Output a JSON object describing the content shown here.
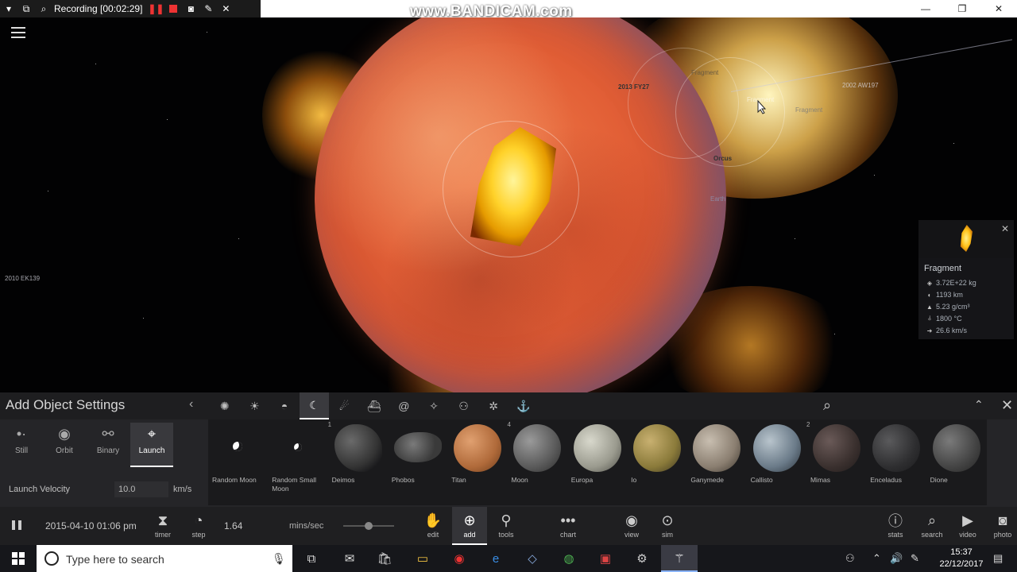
{
  "recorder": {
    "status_text": "Recording [00:02:29]",
    "watermark": "www.BANDICAM.com"
  },
  "space": {
    "labels": {
      "fy27": "2013 FY27",
      "fragment_1": "Fragment",
      "fragment_2": "Fragment",
      "fragment_3": "Fragment",
      "orcus": "Orcus",
      "earth": "Earth",
      "aw197": "2002 AW197",
      "ek139": "2010 EK139"
    }
  },
  "info_panel": {
    "name": "Fragment",
    "mass": "3.72E+22 kg",
    "radius": "1193 km",
    "density": "5.23 g/cm³",
    "temperature": "1800 °C",
    "velocity": "26.6 km/s"
  },
  "panel": {
    "title": "Add Object Settings",
    "modes": [
      {
        "label": "Still",
        "icon": "still-icon"
      },
      {
        "label": "Orbit",
        "icon": "orbit-icon"
      },
      {
        "label": "Binary",
        "icon": "binary-icon"
      },
      {
        "label": "Launch",
        "icon": "launch-crosshair-icon"
      }
    ],
    "active_mode": "Launch",
    "launch_velocity_label": "Launch Velocity",
    "launch_velocity_value": "10.0",
    "launch_velocity_unit": "km/s",
    "category_tabs": [
      "galaxy-icon",
      "star-icon",
      "planet-icon",
      "moon-icon",
      "comet-icon",
      "spacecraft-icon",
      "spiral-icon",
      "asteroid-icon",
      "people-icon",
      "settings-icon",
      "anchor-icon"
    ],
    "active_category": "moon-icon",
    "objects": [
      {
        "name": "Random Moon",
        "badge": ""
      },
      {
        "name": "Random Small Moon",
        "badge": ""
      },
      {
        "name": "Deimos",
        "badge": "1"
      },
      {
        "name": "Phobos",
        "badge": ""
      },
      {
        "name": "Titan",
        "badge": ""
      },
      {
        "name": "Moon",
        "badge": "4"
      },
      {
        "name": "Europa",
        "badge": ""
      },
      {
        "name": "Io",
        "badge": ""
      },
      {
        "name": "Ganymede",
        "badge": ""
      },
      {
        "name": "Callisto",
        "badge": ""
      },
      {
        "name": "Mimas",
        "badge": "2"
      },
      {
        "name": "Enceladus",
        "badge": ""
      },
      {
        "name": "Dione",
        "badge": ""
      }
    ]
  },
  "simbar": {
    "date": "2015-04-10 01:06 pm",
    "speed": "1.64",
    "speed_unit": "mins/sec",
    "speed_fraction": 0.5,
    "timer_label": "timer",
    "step_label": "step",
    "edit_label": "edit",
    "add_label": "add",
    "tools_label": "tools",
    "chart_label": "chart",
    "view_label": "view",
    "sim_label": "sim",
    "stats_label": "stats",
    "search_label": "search",
    "video_label": "video",
    "photo_label": "photo"
  },
  "taskbar": {
    "search_placeholder": "Type here to search",
    "time": "15:37",
    "date": "22/12/2017"
  }
}
